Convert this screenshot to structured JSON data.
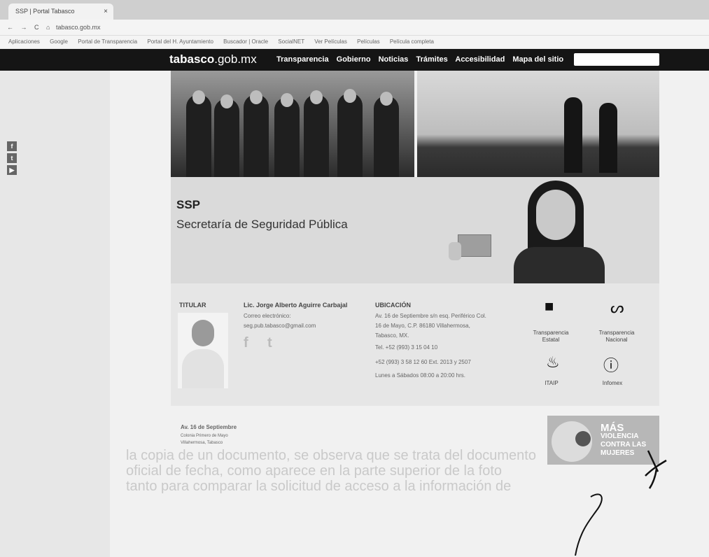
{
  "browser": {
    "tab_title": "SSP | Portal Tabasco",
    "tab_close": "×",
    "nav_buttons": "← → C ⌂",
    "url": "tabasco.gob.mx",
    "bookmarks": [
      "Aplicaciones",
      "Google",
      "Portal de Transparencia",
      "Portal del H. Ayuntamiento",
      "Buscador | Oracle",
      "SocialNET",
      "Ver Películas",
      "Películas",
      "Película completa"
    ]
  },
  "site": {
    "logo_bold": "tabasco",
    "logo_rest": ".gob.mx",
    "menu": [
      "Transparencia",
      "Gobierno",
      "Noticias",
      "Trámites",
      "Accesibilidad",
      "Mapa del sitio"
    ],
    "social": [
      "f",
      "t",
      "▶"
    ]
  },
  "banner": {
    "abbr": "SSP",
    "title": "Secretaría de Seguridad Pública"
  },
  "titular": {
    "label": "TITULAR",
    "name": "Lic. Jorge Alberto Aguirre Carbajal",
    "email_label": "Correo electrónico:",
    "email": "seg.pub.tabasco@gmail.com",
    "social": [
      "f",
      "t"
    ]
  },
  "ubicacion": {
    "label": "UBICACIÓN",
    "lines": [
      "Av. 16 de Septiembre s/n esq. Periférico Col.",
      "16 de Mayo, C.P. 86180 Villahermosa,",
      "Tabasco, MX.",
      "Tel. +52 (993) 3 15 04 10",
      "+52 (993) 3 58 12 60 Ext. 2013 y 2507",
      "Lunes a Sábados 08:00 a 20:00 hrs."
    ]
  },
  "transparency": [
    {
      "icon_name": "document-icon",
      "glyph": "■",
      "label": "Transparencia Estatal"
    },
    {
      "icon_name": "swirl-icon",
      "glyph": "ᔕ",
      "label": "Transparencia Nacional"
    },
    {
      "icon_name": "itaip-icon",
      "glyph": "♨",
      "label": "ITAIP"
    },
    {
      "icon_name": "infomex-icon",
      "glyph": "ⓘ",
      "label": "Infomex"
    }
  ],
  "footer": {
    "address": [
      "Av. 16 de Septiembre",
      "Colonia Primero de Mayo",
      "Villahermosa, Tabasco"
    ],
    "campaign": {
      "line1": "MÁS",
      "line2": "VIOLENCIA",
      "line3": "CONTRA LAS",
      "line4": "MUJERES"
    }
  },
  "document_text": [
    "la copia de un documento, se observa que se trata del documento",
    "oficial de fecha, como aparece en la parte superior de la foto",
    "tanto para comparar la solicitud de acceso a la información de"
  ]
}
